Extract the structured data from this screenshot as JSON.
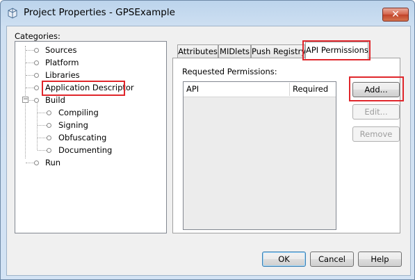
{
  "window": {
    "title": "Project Properties - GPSExample",
    "close_glyph": "✕"
  },
  "categories": {
    "label": "Categories:",
    "items": [
      {
        "label": "Sources",
        "level": 0
      },
      {
        "label": "Platform",
        "level": 0
      },
      {
        "label": "Libraries",
        "level": 0
      },
      {
        "label": "Application Descriptor",
        "level": 0,
        "selected": true
      },
      {
        "label": "Build",
        "level": 0,
        "expanded": true
      },
      {
        "label": "Compiling",
        "level": 1
      },
      {
        "label": "Signing",
        "level": 1
      },
      {
        "label": "Obfuscating",
        "level": 1
      },
      {
        "label": "Documenting",
        "level": 1
      },
      {
        "label": "Run",
        "level": 0
      }
    ]
  },
  "tabs": [
    "Attributes",
    "MIDlets",
    "Push Registry",
    "API Permissions"
  ],
  "active_tab": "API Permissions",
  "permissions": {
    "label": "Requested Permissions:",
    "columns": [
      "API",
      "Required"
    ],
    "rows": []
  },
  "side_buttons": {
    "add": "Add...",
    "edit": "Edit...",
    "remove": "Remove"
  },
  "footer_buttons": {
    "ok": "OK",
    "cancel": "Cancel",
    "help": "Help"
  },
  "colors": {
    "highlight": "#e0262b",
    "titlebar": "#bcd4ec"
  },
  "icons": {
    "app": "project-icon",
    "close": "close-icon",
    "node": "tree-node-icon",
    "expander": "collapse-icon"
  }
}
